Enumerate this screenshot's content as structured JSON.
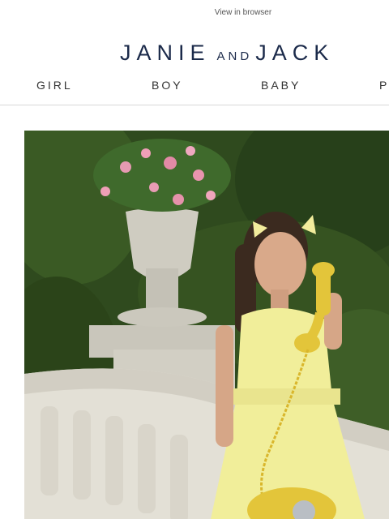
{
  "header": {
    "view_in_browser": "View in browser",
    "logo": {
      "word1": "JANIE",
      "connector": "AND",
      "word2": "JACK",
      "color": "#1b2a4a"
    }
  },
  "nav": {
    "items": [
      {
        "label": "GIRL"
      },
      {
        "label": "BOY"
      },
      {
        "label": "BABY"
      },
      {
        "label": "P"
      }
    ]
  },
  "hero": {
    "icon": "photo-girl-yellow-dress-telephone",
    "colors": {
      "foliage": "#2f4a1e",
      "dress": "#f1ee9a",
      "phone": "#e3c53a",
      "stone": "#d9d6cc"
    }
  }
}
